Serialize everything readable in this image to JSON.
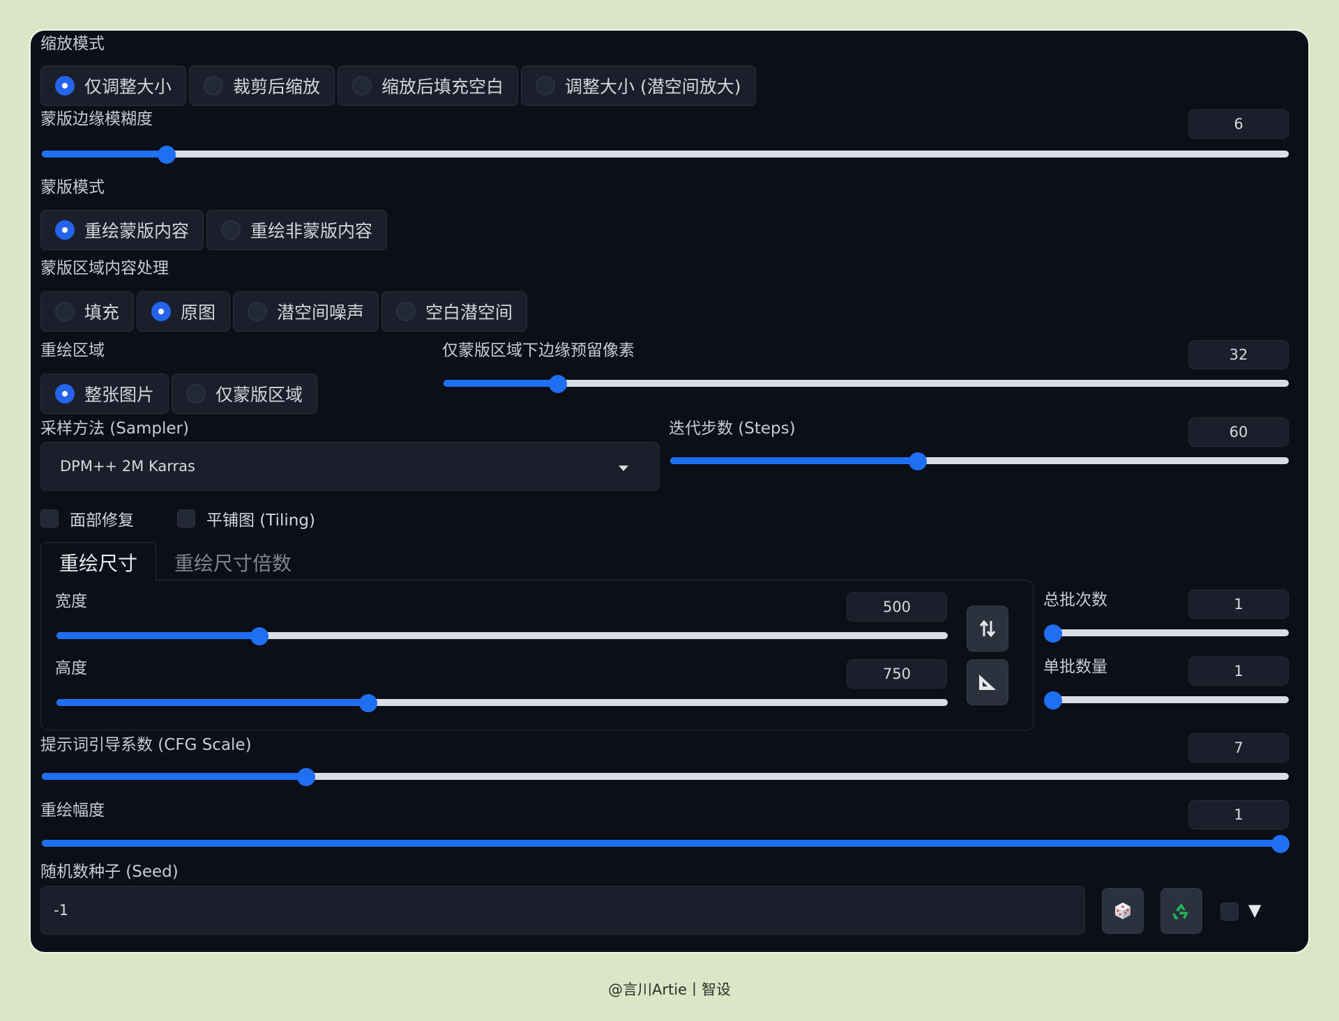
{
  "resize_mode": {
    "label": "缩放模式",
    "options": [
      "仅调整大小",
      "裁剪后缩放",
      "缩放后填充空白",
      "调整大小 (潜空间放大)"
    ],
    "selected": 0
  },
  "mask_blur": {
    "label": "蒙版边缘模糊度",
    "value": "6",
    "fraction": 0.1
  },
  "mask_mode": {
    "label": "蒙版模式",
    "options": [
      "重绘蒙版内容",
      "重绘非蒙版内容"
    ],
    "selected": 0
  },
  "masked_content": {
    "label": "蒙版区域内容处理",
    "options": [
      "填充",
      "原图",
      "潜空间噪声",
      "空白潜空间"
    ],
    "selected": 1
  },
  "inpaint_area": {
    "label": "重绘区域",
    "options": [
      "整张图片",
      "仅蒙版区域"
    ],
    "selected": 0
  },
  "only_masked_padding": {
    "label": "仅蒙版区域下边缘预留像素",
    "value": "32",
    "fraction": 0.135
  },
  "sampler": {
    "label": "采样方法 (Sampler)",
    "value": "DPM++ 2M Karras"
  },
  "steps": {
    "label": "迭代步数 (Steps)",
    "value": "60",
    "fraction": 0.4
  },
  "checkboxes": {
    "restore_faces": {
      "label": "面部修复",
      "checked": false
    },
    "tiling": {
      "label": "平铺图 (Tiling)",
      "checked": false
    }
  },
  "tabs": {
    "resize_to": "重绘尺寸",
    "resize_by": "重绘尺寸倍数",
    "active": 0
  },
  "width": {
    "label": "宽度",
    "value": "500",
    "fraction": 0.228
  },
  "height": {
    "label": "高度",
    "value": "750",
    "fraction": 0.35
  },
  "batch_count": {
    "label": "总批次数",
    "value": "1",
    "fraction": 0.0
  },
  "batch_size": {
    "label": "单批数量",
    "value": "1",
    "fraction": 0.0
  },
  "cfg_scale": {
    "label": "提示词引导系数 (CFG Scale)",
    "value": "7",
    "fraction": 0.212
  },
  "denoising": {
    "label": "重绘幅度",
    "value": "1",
    "fraction": 1.0
  },
  "seed": {
    "label": "随机数种子 (Seed)",
    "value": "-1"
  },
  "icons": {
    "swap": "swap-dimensions-icon",
    "ruler": "set-square-icon",
    "dice": "dice-icon",
    "recycle": "recycle-icon",
    "extra_arrow": "▼"
  },
  "colors": {
    "accent": "#1f6ff2",
    "panel": "#0c0f17",
    "page": "#dbe6c6"
  },
  "footer": "@言川Artie丨智设"
}
